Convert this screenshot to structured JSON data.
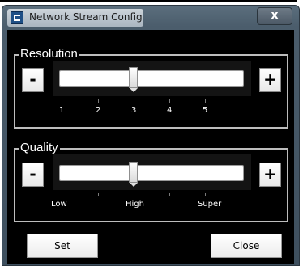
{
  "window": {
    "title": "Network Stream Config",
    "close_label": "x"
  },
  "resolution": {
    "label": "Resolution",
    "minus_label": "-",
    "plus_label": "+",
    "ticks": [
      "1",
      "2",
      "3",
      "4",
      "5"
    ],
    "selected_index": 2
  },
  "quality": {
    "label": "Quality",
    "minus_label": "-",
    "plus_label": "+",
    "ticks": [
      "Low",
      "High",
      "Super"
    ],
    "selected_index": 1
  },
  "buttons": {
    "set_label": "Set",
    "close_label": "Close"
  },
  "colors": {
    "client_bg": "#000000",
    "frame": "#4b5d6c"
  }
}
